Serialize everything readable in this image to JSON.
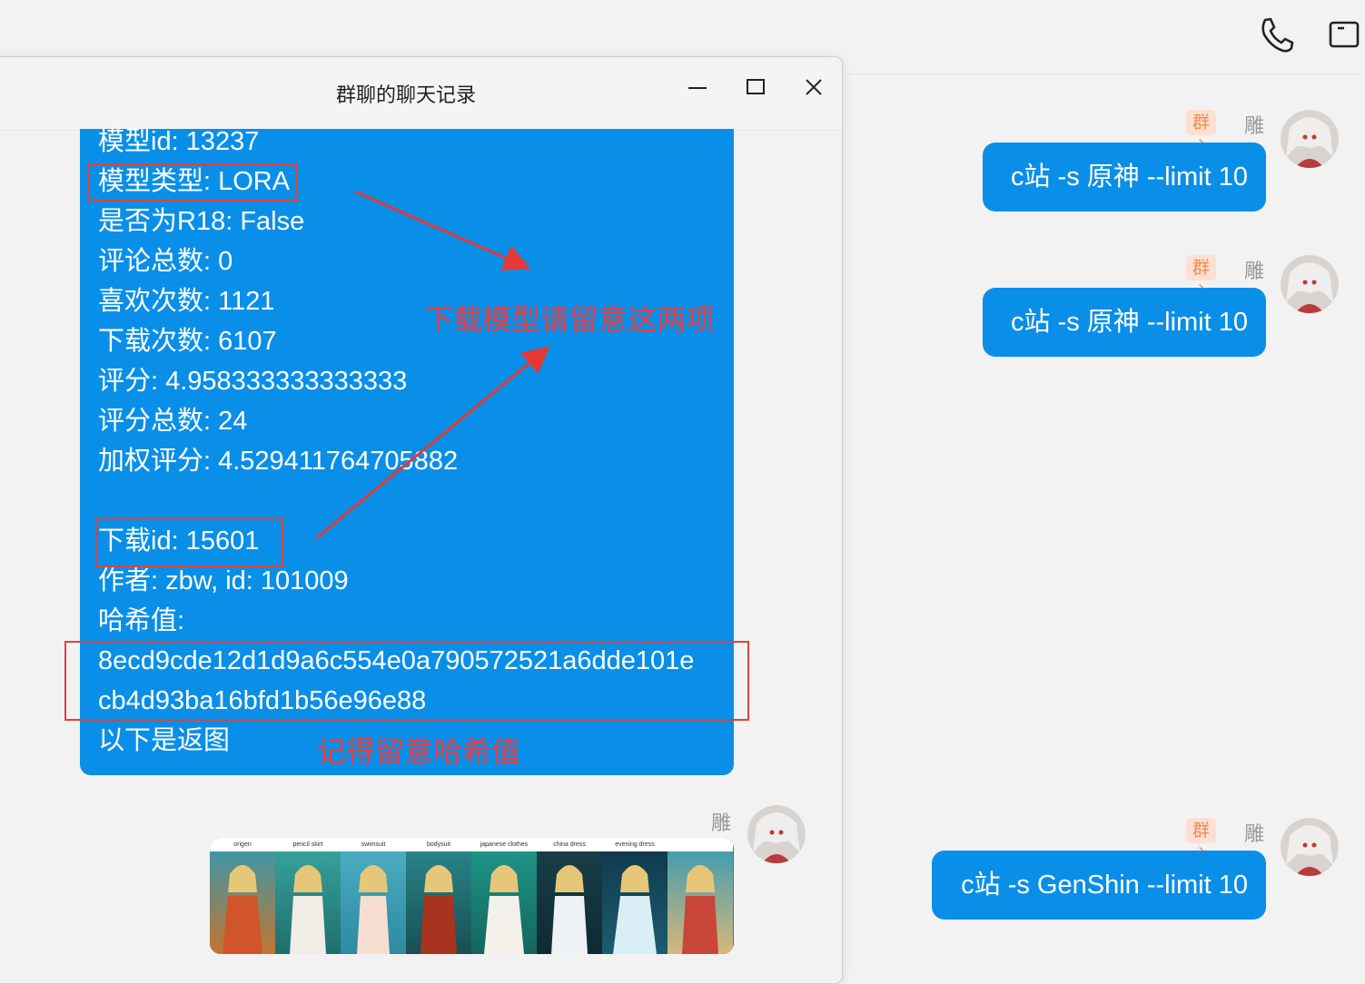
{
  "main": {
    "header": {
      "phone_icon": "phone-icon",
      "video_icon": "video-camera-icon"
    },
    "messages": [
      {
        "badge": "群主",
        "user": "雕",
        "text": "c站 -s 原神 --limit 10"
      },
      {
        "badge": "群主",
        "user": "雕",
        "text": "c站 -s 原神 --limit 10"
      },
      {
        "badge": "群主",
        "user": "雕",
        "text": "c站 -s GenShin --limit 10"
      }
    ]
  },
  "popup": {
    "title": "群聊的聊天记录",
    "controls": [
      "minimize",
      "maximize",
      "close"
    ],
    "bubble_lines": [
      "模型id: 13237",
      "模型类型: LORA",
      "是否为R18: False",
      "评论总数: 0",
      "喜欢次数: 1121",
      "下载次数: 6107",
      "评分: 4.958333333333333",
      "评分总数: 24",
      "加权评分: 4.529411764705882",
      "下载id: 15601",
      " 作者: zbw, id: 101009",
      "哈希值:",
      "8ecd9cde12d1d9a6c554e0a790572521a6dde101e",
      "cb4d93ba16bfd1b56e96e88",
      "以下是返图"
    ],
    "annotations": {
      "note1": "下载模型请留意这两项",
      "note2": "记得留意哈希值"
    },
    "image_sender": "雕",
    "image_labels": [
      "origen",
      "pencil skirt",
      "swimsuit",
      "bodysuit",
      "japanese clothes",
      "china dress",
      "evening dress",
      ""
    ]
  }
}
